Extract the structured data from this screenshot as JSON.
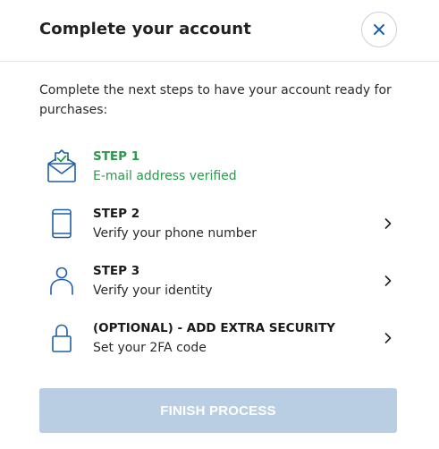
{
  "header": {
    "title": "Complete your account",
    "close_icon": "close-icon"
  },
  "intro": "Complete the next steps to have your account ready for purchases:",
  "steps": [
    {
      "label": "STEP 1",
      "description": "E-mail address verified",
      "icon": "envelope-check-icon",
      "status": "done",
      "status_color": "#2a9a4c"
    },
    {
      "label": "STEP 2",
      "description": "Verify your phone number",
      "icon": "phone-icon",
      "status": "pending"
    },
    {
      "label": "STEP 3",
      "description": "Verify your identity",
      "icon": "user-icon",
      "status": "pending"
    },
    {
      "label": "(OPTIONAL) - ADD EXTRA SECURITY",
      "description": "Set your 2FA code",
      "icon": "lock-icon",
      "status": "pending"
    }
  ],
  "finish_button": {
    "label": "FINISH PROCESS",
    "enabled": false
  },
  "colors": {
    "accent": "#1f5fa8",
    "success": "#2a9a4c",
    "disabled_button": "#b9cde3"
  }
}
